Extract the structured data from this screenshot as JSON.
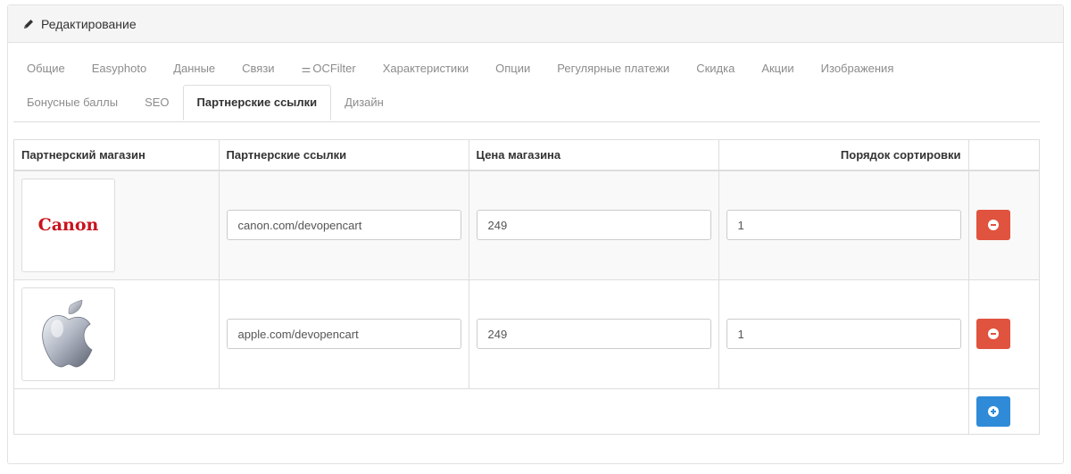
{
  "panel": {
    "title": "Редактирование",
    "icon": "pencil-icon"
  },
  "tabs": {
    "row1": [
      {
        "label": "Общие"
      },
      {
        "label": "Easyphoto"
      },
      {
        "label": "Данные"
      },
      {
        "label": "Связи"
      },
      {
        "label": "OCFilter",
        "icon": "sliders-icon",
        "glyph": "⚌"
      },
      {
        "label": "Характеристики"
      },
      {
        "label": "Опции"
      },
      {
        "label": "Регулярные платежи"
      },
      {
        "label": "Скидка"
      },
      {
        "label": "Акции"
      },
      {
        "label": "Изображения"
      }
    ],
    "row2": [
      {
        "label": "Бонусные баллы"
      },
      {
        "label": "SEO"
      },
      {
        "label": "Партнерские ссылки",
        "active": true
      },
      {
        "label": "Дизайн"
      }
    ]
  },
  "table": {
    "headers": {
      "store": "Партнерский магазин",
      "links": "Партнерские ссылки",
      "price": "Цена магазина",
      "sort": "Порядок сортировки"
    },
    "rows": [
      {
        "logo": "Canon",
        "logo_icon": "canon-logo",
        "link": "canon.com/devopencart",
        "price": "249",
        "sort": "1"
      },
      {
        "logo": "",
        "logo_icon": "apple-logo",
        "link": "apple.com/devopencart",
        "price": "249",
        "sort": "1"
      }
    ]
  },
  "colors": {
    "danger": "#e0533e",
    "primary": "#2f8bd8",
    "canon_red": "#c8141e"
  }
}
